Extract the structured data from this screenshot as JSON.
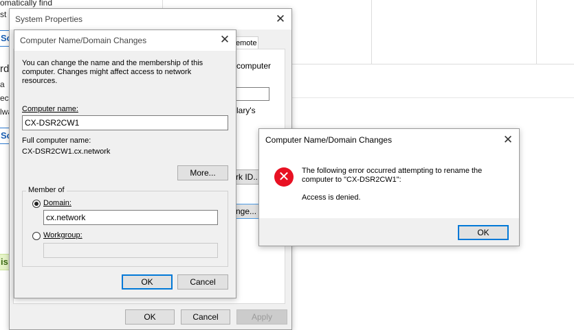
{
  "background_app": {
    "frag_1": "omatically find",
    "frag_2": "st",
    "btn_frag_1": "Sca",
    "frag_3": "rd",
    "frag_4": "a",
    "frag_5": "ect",
    "frag_6": "lwa",
    "btn_frag_2": "Sca",
    "green_frag": "is"
  },
  "system_properties": {
    "title": "System Properties",
    "tab_remote": "emote",
    "frag_computer": "computer",
    "frag_library": "lary's",
    "network_id_button": "rk ID...",
    "change_button": "nge...",
    "ok": "OK",
    "cancel": "Cancel",
    "apply": "Apply"
  },
  "name_changes_dialog": {
    "title": "Computer Name/Domain Changes",
    "description": "You can change the name and the membership of this computer. Changes might affect access to network resources.",
    "computer_name_label": "Computer name:",
    "computer_name_value": "CX-DSR2CW1",
    "full_name_label": "Full computer name:",
    "full_name_value": "CX-DSR2CW1.cx.network",
    "more_button": "More...",
    "member_of_label": "Member of",
    "domain_label": "Domain:",
    "domain_value": "cx.network",
    "workgroup_label": "Workgroup:",
    "workgroup_value": "",
    "ok": "OK",
    "cancel": "Cancel"
  },
  "error_dialog": {
    "title": "Computer Name/Domain Changes",
    "message_line1": "The following error occurred attempting to rename the",
    "message_line2": "computer to \"CX-DSR2CW1\":",
    "detail": "Access is denied.",
    "ok": "OK",
    "icon": "error-icon"
  }
}
